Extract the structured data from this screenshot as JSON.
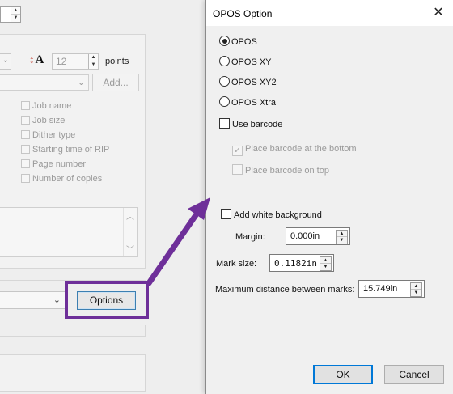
{
  "parent": {
    "font_size_value": "12",
    "points_label": "points",
    "add_label": "Add...",
    "checkbox_items": [
      "Job name",
      "Job size",
      "Dither type",
      "Starting time of RIP",
      "Page number",
      "Number of copies"
    ],
    "options_label": "Options"
  },
  "dialog": {
    "title": "OPOS Option",
    "close_icon": "close-icon",
    "radios": [
      {
        "label": "OPOS",
        "selected": true
      },
      {
        "label": "OPOS XY",
        "selected": false
      },
      {
        "label": "OPOS XY2",
        "selected": false
      },
      {
        "label": "OPOS Xtra",
        "selected": false
      }
    ],
    "use_barcode": {
      "label": "Use barcode",
      "checked": false
    },
    "place_barcode_bottom": {
      "label": "Place barcode at the bottom",
      "checked": true,
      "enabled": false
    },
    "place_barcode_top": {
      "label": "Place barcode on top",
      "checked": false,
      "enabled": false
    },
    "add_white_background": {
      "label": "Add white background",
      "checked": false
    },
    "margin": {
      "label": "Margin:",
      "value": "0.000in"
    },
    "mark_size": {
      "label": "Mark size:",
      "value": "0.1182in"
    },
    "max_distance": {
      "label": "Maximum distance between marks:",
      "value": "15.749in"
    },
    "ok_label": "OK",
    "cancel_label": "Cancel"
  },
  "colors": {
    "highlight": "#6e2f99",
    "accent": "#0078d7"
  }
}
